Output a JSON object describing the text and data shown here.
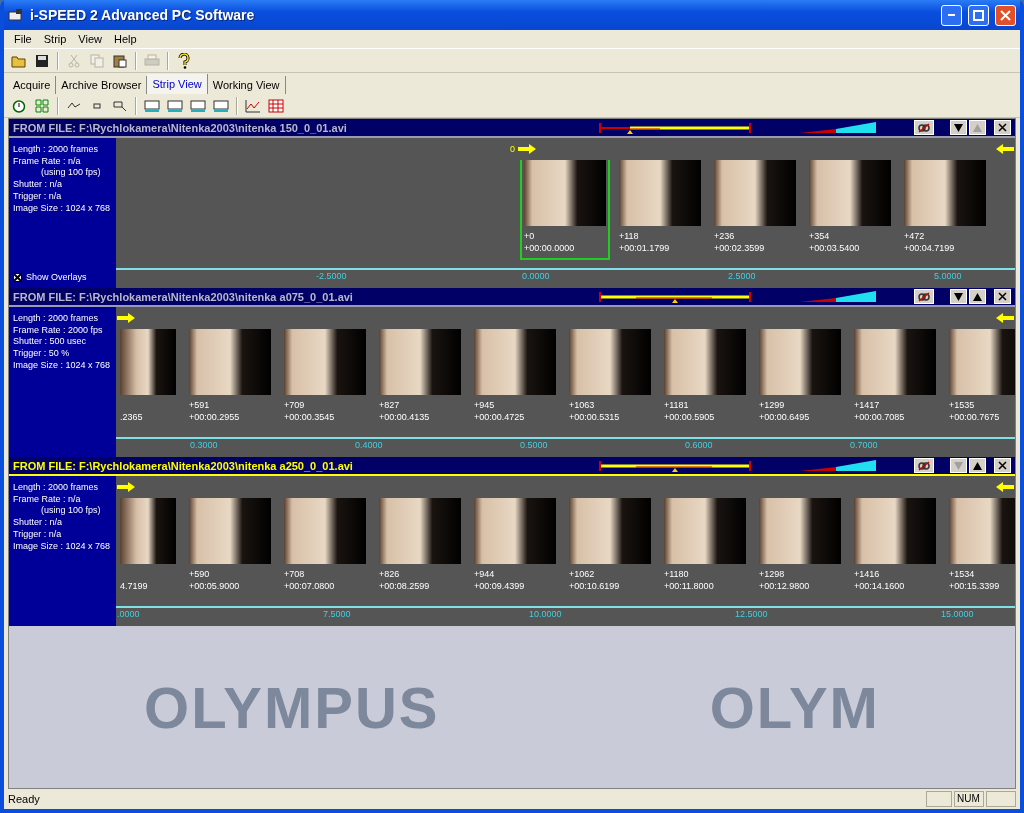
{
  "window": {
    "title": "i-SPEED 2 Advanced PC Software"
  },
  "menu": [
    "File",
    "Strip",
    "View",
    "Help"
  ],
  "toolbar": [
    {
      "kind": "open",
      "disabled": false
    },
    {
      "kind": "save",
      "disabled": false
    },
    {
      "kind": "sep"
    },
    {
      "kind": "cut",
      "disabled": true
    },
    {
      "kind": "copy",
      "disabled": true
    },
    {
      "kind": "paste",
      "disabled": false
    },
    {
      "kind": "sep"
    },
    {
      "kind": "print",
      "disabled": true
    },
    {
      "kind": "sep"
    },
    {
      "kind": "help",
      "disabled": false
    }
  ],
  "tabs": [
    {
      "label": "Acquire",
      "selected": false
    },
    {
      "label": "Archive Browser",
      "selected": false
    },
    {
      "label": "Strip View",
      "selected": true
    },
    {
      "label": "Working View",
      "selected": false
    }
  ],
  "view_toolbar": [
    {
      "kind": "timer"
    },
    {
      "kind": "grid"
    },
    {
      "kind": "sep"
    },
    {
      "kind": "line"
    },
    {
      "kind": "point"
    },
    {
      "kind": "region"
    },
    {
      "kind": "sep"
    },
    {
      "kind": "strip"
    },
    {
      "kind": "strip"
    },
    {
      "kind": "strip"
    },
    {
      "kind": "strip"
    },
    {
      "kind": "sep"
    },
    {
      "kind": "graph"
    },
    {
      "kind": "table"
    }
  ],
  "strips": [
    {
      "title": "FROM FILE: F:\\Rychlokamera\\Nitenka2003\\nitenka 150_0_01.avi",
      "selected": false,
      "up_disabled": true,
      "down_disabled": false,
      "info": [
        {
          "kind": "line",
          "text": "Length : 2000 frames"
        },
        {
          "kind": "line",
          "text": "Frame Rate : n/a"
        },
        {
          "kind": "sub",
          "text": "(using 100 fps)"
        },
        {
          "kind": "line",
          "text": "Shutter : n/a"
        },
        {
          "kind": "line",
          "text": "Trigger : n/a"
        },
        {
          "kind": "line",
          "text": "Image Size : 1024 x 768"
        }
      ],
      "show_overlays": {
        "label": "Show Overlays",
        "checked": true
      },
      "start_marker": "0",
      "frames": [
        {
          "kind": "full",
          "number": "+0",
          "time": "+00:00.0000",
          "selected": true
        },
        {
          "kind": "full",
          "number": "+118",
          "time": "+00:01.1799",
          "selected": false
        },
        {
          "kind": "full",
          "number": "+236",
          "time": "+00:02.3599",
          "selected": false
        },
        {
          "kind": "full",
          "number": "+354",
          "time": "+00:03.5400",
          "selected": false
        },
        {
          "kind": "full",
          "number": "+472",
          "time": "+00:04.7199",
          "selected": false
        }
      ],
      "axis": [
        "-2.5000",
        "0.0000",
        "2.5000",
        "5.0000"
      ]
    },
    {
      "title": "FROM FILE: F:\\Rychlokamera\\Nitenka2003\\nitenka a075_0_01.avi",
      "selected": false,
      "up_disabled": false,
      "down_disabled": false,
      "info": [
        {
          "kind": "line",
          "text": "Length : 2000 frames"
        },
        {
          "kind": "line",
          "text": "Frame Rate : 2000 fps"
        },
        {
          "kind": "line",
          "text": "Shutter : 500 usec"
        },
        {
          "kind": "line",
          "text": "Trigger : 50  %"
        },
        {
          "kind": "line",
          "text": "Image Size : 1024 x 768"
        }
      ],
      "frames": [
        {
          "kind": "partial",
          "time": ".2365",
          "selected": false
        },
        {
          "kind": "full",
          "number": "+591",
          "time": "+00:00.2955",
          "selected": false
        },
        {
          "kind": "full",
          "number": "+709",
          "time": "+00:00.3545",
          "selected": false
        },
        {
          "kind": "full",
          "number": "+827",
          "time": "+00:00.4135",
          "selected": false
        },
        {
          "kind": "full",
          "number": "+945",
          "time": "+00:00.4725",
          "selected": false
        },
        {
          "kind": "full",
          "number": "+1063",
          "time": "+00:00.5315",
          "selected": false
        },
        {
          "kind": "full",
          "number": "+1181",
          "time": "+00:00.5905",
          "selected": false
        },
        {
          "kind": "full",
          "number": "+1299",
          "time": "+00:00.6495",
          "selected": false
        },
        {
          "kind": "full",
          "number": "+1417",
          "time": "+00:00.7085",
          "selected": false
        },
        {
          "kind": "full",
          "number": "+1535",
          "time": "+00:00.7675",
          "selected": false
        }
      ],
      "axis": [
        "0.3000",
        "0.4000",
        "0.5000",
        "0.6000",
        "0.7000"
      ]
    },
    {
      "title": "FROM FILE: F:\\Rychlokamera\\Nitenka2003\\nitenka a250_0_01.avi",
      "selected": true,
      "up_disabled": false,
      "down_disabled": true,
      "info": [
        {
          "kind": "line",
          "text": "Length : 2000 frames"
        },
        {
          "kind": "line",
          "text": "Frame Rate : n/a"
        },
        {
          "kind": "sub",
          "text": "(using 100 fps)"
        },
        {
          "kind": "line",
          "text": "Shutter : n/a"
        },
        {
          "kind": "line",
          "text": "Trigger : n/a"
        },
        {
          "kind": "line",
          "text": "Image Size : 1024 x 768"
        }
      ],
      "frames": [
        {
          "kind": "partial",
          "time": "4.7199",
          "selected": false
        },
        {
          "kind": "full",
          "number": "+590",
          "time": "+00:05.9000",
          "selected": false
        },
        {
          "kind": "full",
          "number": "+708",
          "time": "+00:07.0800",
          "selected": false
        },
        {
          "kind": "full",
          "number": "+826",
          "time": "+00:08.2599",
          "selected": false
        },
        {
          "kind": "full",
          "number": "+944",
          "time": "+00:09.4399",
          "selected": false
        },
        {
          "kind": "full",
          "number": "+1062",
          "time": "+00:10.6199",
          "selected": false
        },
        {
          "kind": "full",
          "number": "+1180",
          "time": "+00:11.8000",
          "selected": false
        },
        {
          "kind": "full",
          "number": "+1298",
          "time": "+00:12.9800",
          "selected": false
        },
        {
          "kind": "full",
          "number": "+1416",
          "time": "+00:14.1600",
          "selected": false
        },
        {
          "kind": "full",
          "number": "+1534",
          "time": "+00:15.3399",
          "selected": false
        }
      ],
      "axis": [
        ".0000",
        "7.5000",
        "10.0000",
        "12.5000",
        "15.0000"
      ]
    }
  ],
  "background_logo": [
    "OLYMPUS",
    "OLYM"
  ],
  "status_bar": {
    "text": "Ready",
    "indicators": [
      "NUM"
    ]
  }
}
